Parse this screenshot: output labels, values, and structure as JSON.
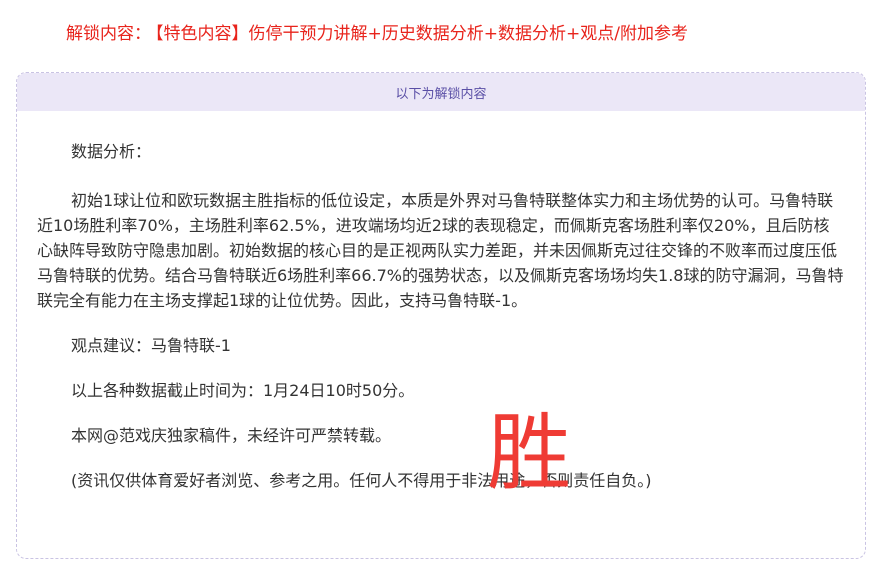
{
  "header": {
    "label": "解锁内容：",
    "content": "【特色内容】伤停干预力讲解+历史数据分析+数据分析+观点/附加参考"
  },
  "card": {
    "banner": "以下为解锁内容",
    "heading": "数据分析：",
    "analysis": "初始1球让位和欧玩数据主胜指标的低位设定，本质是外界对马鲁特联整体实力和主场优势的认可。马鲁特联近10场胜利率70%，主场胜利率62.5%，进攻端场均近2球的表现稳定，而佩斯克客场胜利率仅20%，且后防核心缺阵导致防守隐患加剧。初始数据的核心目的是正视两队实力差距，并未因佩斯克过往交锋的不败率而过度压低马鲁特联的优势。结合马鲁特联近6场胜利率66.7%的强势状态，以及佩斯克客场场均失1.8球的防守漏洞，马鲁特联完全有能力在主场支撑起1球的让位优势。因此，支持马鲁特联-1。",
    "view": "观点建议：马鲁特联-1",
    "time": "以上各种数据截止时间为：1月24日10时50分。",
    "copyright": "本网@范戏庆独家稿件，未经许可严禁转载。",
    "disclaimer": "(资讯仅供体育爱好者浏览、参考之用。任何人不得用于非法用途，否则责任自负。)"
  },
  "result": {
    "text": "胜",
    "color": "#ef3b34"
  }
}
